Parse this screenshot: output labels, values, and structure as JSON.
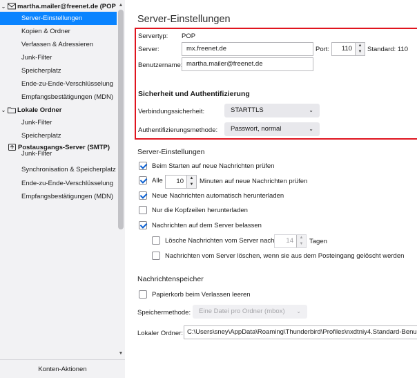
{
  "sidebar": {
    "accounts": [
      {
        "name": "martha.mailer@freenet.de (POP",
        "icon": "envelope-icon",
        "items": [
          "Server-Einstellungen",
          "Kopien & Ordner",
          "Verfassen & Adressieren",
          "Junk-Filter",
          "Speicherplatz",
          "Ende-zu-Ende-Verschlüsselung",
          "Empfangsbestätigungen (MDN)"
        ],
        "selected_index": 0
      },
      {
        "name": "Lokale Ordner",
        "icon": "folder-icon",
        "items": [
          "Junk-Filter",
          "Speicherplatz"
        ]
      },
      {
        "name": "Postausgangs-Server (SMTP)",
        "icon": "outgoing-server-icon",
        "items": [
          "Junk-Filter",
          "Synchronisation & Speicherplatz",
          "Ende-zu-Ende-Verschlüsselung",
          "Empfangsbestätigungen (MDN)"
        ]
      }
    ],
    "footer": {
      "konten_aktionen": "Konten-Aktionen"
    }
  },
  "main": {
    "title": "Server-Einstellungen",
    "servertyp": {
      "label": "Servertyp:",
      "value": "POP"
    },
    "server": {
      "label": "Server:",
      "value": "mx.freenet.de"
    },
    "port": {
      "label": "Port:",
      "value": "110",
      "standard": "Standard: 110"
    },
    "benutzername": {
      "label": "Benutzername:",
      "value": "martha.mailer@freenet.de"
    },
    "security": {
      "heading": "Sicherheit und Authentifizierung",
      "verbindung_label": "Verbindungssicherheit:",
      "verbindung_value": "STARTTLS",
      "auth_label": "Authentifizierungsmethode:",
      "auth_value": "Passwort, normal"
    },
    "server_settings": {
      "heading": "Server-Einstellungen",
      "check_on_start": {
        "label": "Beim Starten auf neue Nachrichten prüfen",
        "checked": true
      },
      "check_every": {
        "label_pre": "Alle",
        "value": "10",
        "label_post": "Minuten auf neue Nachrichten prüfen",
        "checked": true
      },
      "auto_download": {
        "label": "Neue Nachrichten automatisch herunterladen",
        "checked": true
      },
      "headers_only": {
        "label": "Nur die Kopfzeilen herunterladen",
        "checked": false
      },
      "leave_on_server": {
        "label": "Nachrichten auf dem Server belassen",
        "checked": true
      },
      "delete_after": {
        "label": "Lösche Nachrichten vom Server nach",
        "value": "14",
        "unit": "Tagen",
        "checked": false
      },
      "delete_when_removed": {
        "label": "Nachrichten vom Server löschen, wenn sie aus dem Posteingang gelöscht werden",
        "checked": false
      }
    },
    "storage": {
      "heading": "Nachrichtenspeicher",
      "empty_trash": {
        "label": "Papierkorb beim Verlassen leeren",
        "checked": false
      },
      "method_label": "Speichermethode:",
      "method_value": "Eine Datei pro Ordner (mbox)",
      "local_dir_label": "Lokaler Ordner:",
      "local_dir_value": "C:\\Users\\sney\\AppData\\Roaming\\Thunderbird\\Profiles\\nxdtniy4.Standard-Benu"
    }
  }
}
